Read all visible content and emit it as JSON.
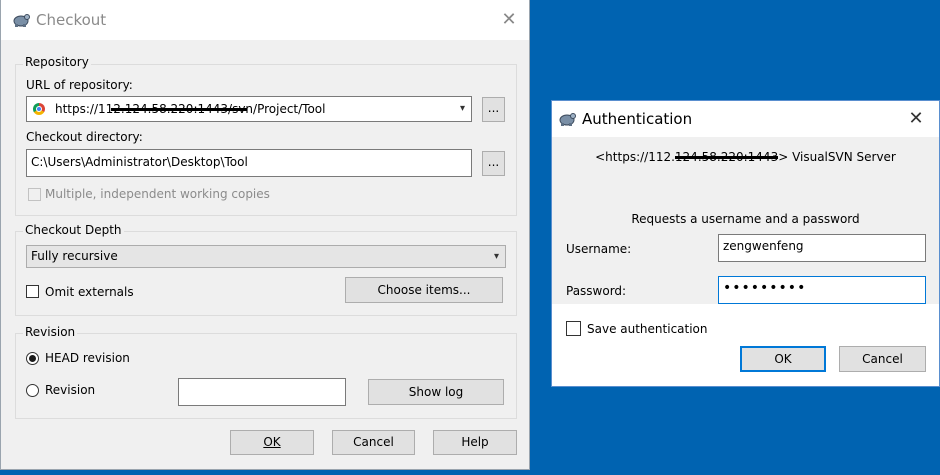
{
  "checkout": {
    "title": "Checkout",
    "repository_group": "Repository",
    "url_label": "URL of repository:",
    "url_value": "https://112.124.58.220:1443/svn/Project/Tool",
    "browse_label": "...",
    "dir_label": "Checkout directory:",
    "dir_value": "C:\\Users\\Administrator\\Desktop\\Tool",
    "multiple_label": "Multiple, independent working copies",
    "depth_group": "Checkout Depth",
    "depth_value": "Fully recursive",
    "omit_label": "Omit externals",
    "choose_items": "Choose items...",
    "revision_group": "Revision",
    "head_revision": "HEAD revision",
    "revision_label": "Revision",
    "revision_value": "",
    "show_log": "Show log",
    "ok": "OK",
    "cancel": "Cancel",
    "help": "Help"
  },
  "auth": {
    "title": "Authentication",
    "server": "<https://112.124.58.220:1443> VisualSVN Server",
    "request": "Requests a username and a password",
    "username_label": "Username:",
    "username_value": "zengwenfeng",
    "password_label": "Password:",
    "password_value": "•••••••••",
    "save_label": "Save authentication",
    "ok": "OK",
    "cancel": "Cancel"
  },
  "icons": [
    "tortoisesvn-icon",
    "close-icon",
    "chrome-icon",
    "dropdown-arrow-icon"
  ],
  "colors": {
    "desktop": "#0063b1",
    "accent": "#0078d7"
  }
}
